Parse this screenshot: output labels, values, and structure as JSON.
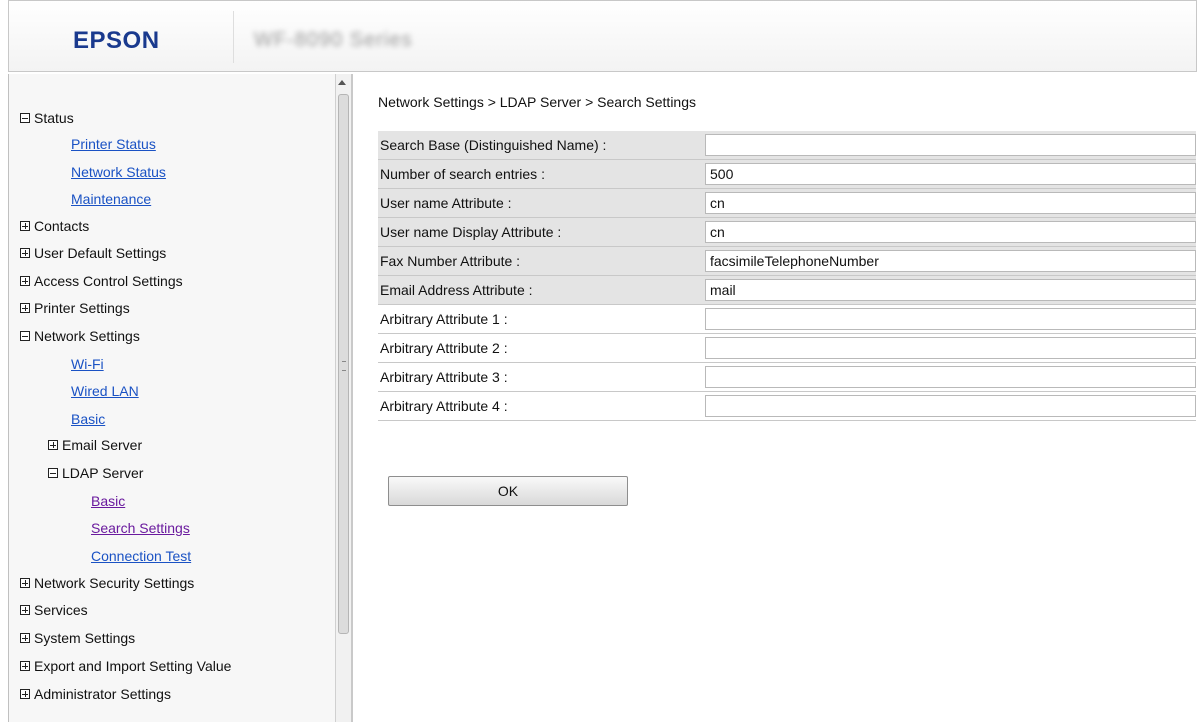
{
  "header": {
    "logo": "EPSON",
    "model": "WF-8090 Series"
  },
  "sidebar": {
    "status": "Status",
    "printer_status": "Printer Status",
    "network_status": "Network Status",
    "maintenance": "Maintenance",
    "contacts": "Contacts",
    "user_default_settings": "User Default Settings",
    "access_control_settings": "Access Control Settings",
    "printer_settings": "Printer Settings",
    "network_settings": "Network Settings",
    "wifi": "Wi-Fi",
    "wired_lan": "Wired LAN",
    "basic": "Basic",
    "email_server": "Email Server",
    "ldap_server": "LDAP Server",
    "ldap_basic": "Basic",
    "search_settings": "Search Settings",
    "connection_test": "Connection Test",
    "network_security_settings": "Network Security Settings",
    "services": "Services",
    "system_settings": "System Settings",
    "export_import": "Export and Import Setting Value",
    "administrator_settings": "Administrator Settings"
  },
  "main": {
    "breadcrumb": "Network Settings > LDAP Server > Search Settings",
    "fields": [
      {
        "label": "Search Base (Distinguished Name) :",
        "value": ""
      },
      {
        "label": "Number of search entries :",
        "value": "500"
      },
      {
        "label": "User name Attribute :",
        "value": "cn"
      },
      {
        "label": "User name Display Attribute :",
        "value": "cn"
      },
      {
        "label": "Fax Number Attribute :",
        "value": "facsimileTelephoneNumber"
      },
      {
        "label": "Email Address Attribute :",
        "value": "mail"
      },
      {
        "label": "Arbitrary Attribute 1 :",
        "value": ""
      },
      {
        "label": "Arbitrary Attribute 2 :",
        "value": ""
      },
      {
        "label": "Arbitrary Attribute 3 :",
        "value": ""
      },
      {
        "label": "Arbitrary Attribute 4 :",
        "value": ""
      }
    ],
    "ok_label": "OK"
  },
  "colors": {
    "logo": "#1a3a8e",
    "link": "#1a52c4",
    "visited_link": "#6a1a9e",
    "shaded_row": "#e4e4e4"
  }
}
